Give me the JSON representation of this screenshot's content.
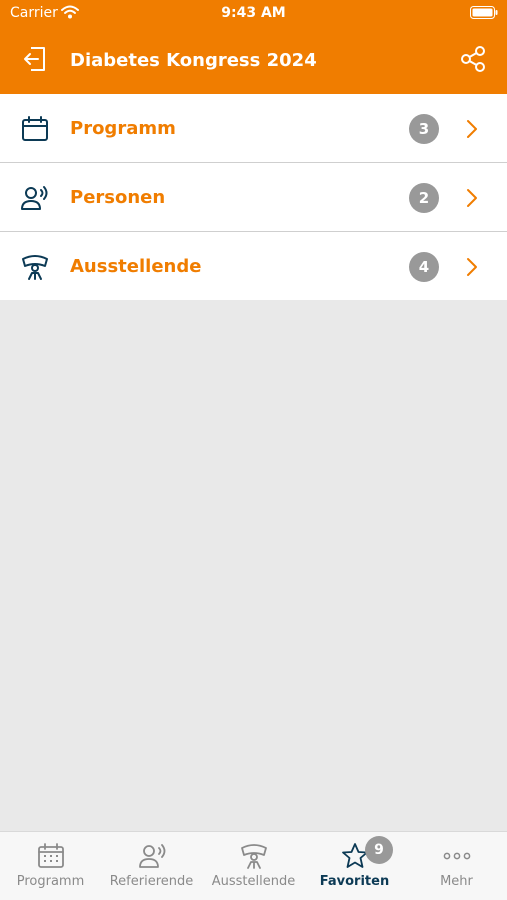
{
  "status_bar": {
    "carrier": "Carrier",
    "time": "9:43 AM"
  },
  "header": {
    "title": "Diabetes Kongress 2024"
  },
  "list": {
    "items": [
      {
        "label": "Programm",
        "count": "3",
        "icon": "calendar-icon"
      },
      {
        "label": "Personen",
        "count": "2",
        "icon": "speaker-person-icon"
      },
      {
        "label": "Ausstellende",
        "count": "4",
        "icon": "exhibitor-booth-icon"
      }
    ]
  },
  "tabbar": {
    "tabs": [
      {
        "label": "Programm",
        "icon": "calendar-icon"
      },
      {
        "label": "Referierende",
        "icon": "speaker-person-icon"
      },
      {
        "label": "Ausstellende",
        "icon": "exhibitor-booth-icon"
      },
      {
        "label": "Favoriten",
        "icon": "star-icon",
        "badge": "9",
        "active": true
      },
      {
        "label": "Mehr",
        "icon": "more-dots-icon"
      }
    ]
  },
  "colors": {
    "accent": "#f07d00",
    "icon_dark": "#0c3a55",
    "badge_gray": "#999999"
  }
}
